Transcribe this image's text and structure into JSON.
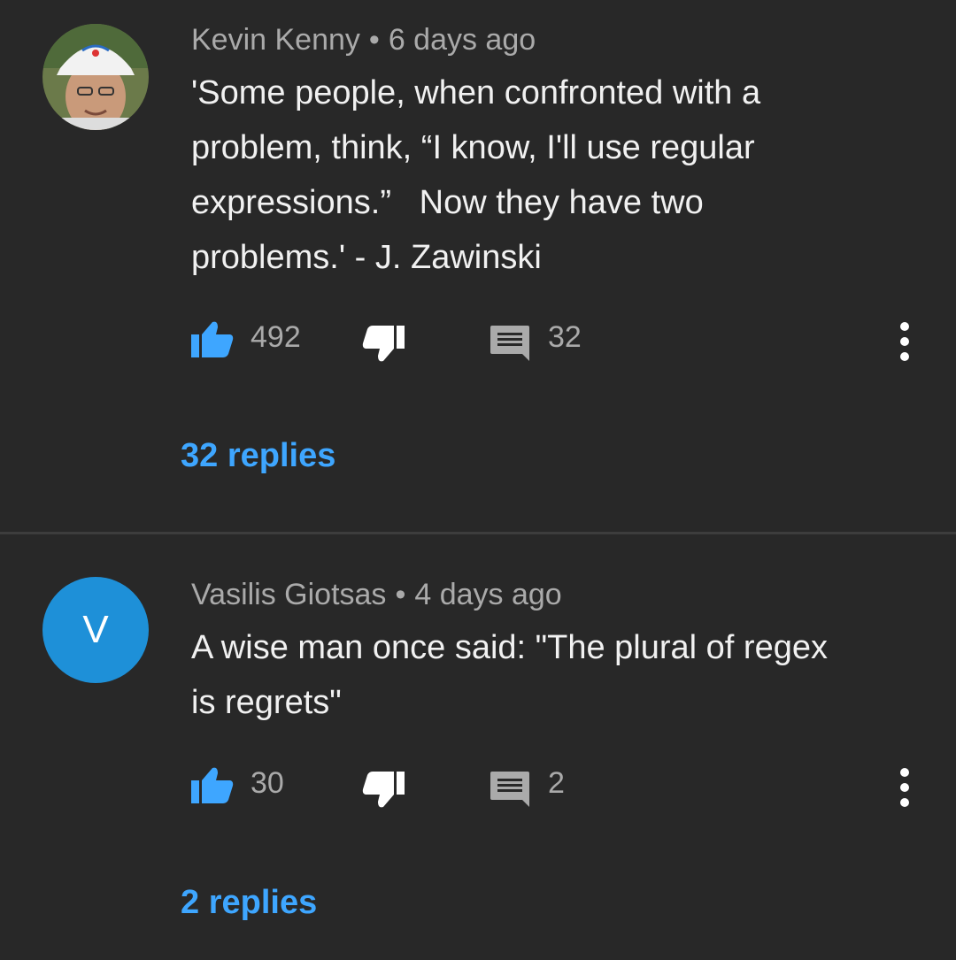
{
  "comments": [
    {
      "author": "Kevin Kenny",
      "separator": "•",
      "time": "6 days ago",
      "avatar": {
        "type": "photo",
        "description_icon": "user-photo-avatar"
      },
      "text": "'Some people, when confronted with a\nproblem, think, “I know, I'll use regular\nexpressions.”   Now they have two\nproblems.' - J. Zawinski",
      "likes": "492",
      "reply_count": "32",
      "replies_label": "32 replies"
    },
    {
      "author": "Vasilis Giotsas",
      "separator": "•",
      "time": "4 days ago",
      "avatar": {
        "type": "letter",
        "letter": "V",
        "color": "#1e90d8"
      },
      "text": "A wise man once said: \"The plural of regex\nis regrets\"",
      "likes": "30",
      "reply_count": "2",
      "replies_label": "2 replies"
    }
  ],
  "colors": {
    "background": "#282828",
    "like_icon": "#3ea6ff",
    "icon_gray": "#aaaaaa",
    "link_blue": "#3ea6ff"
  }
}
